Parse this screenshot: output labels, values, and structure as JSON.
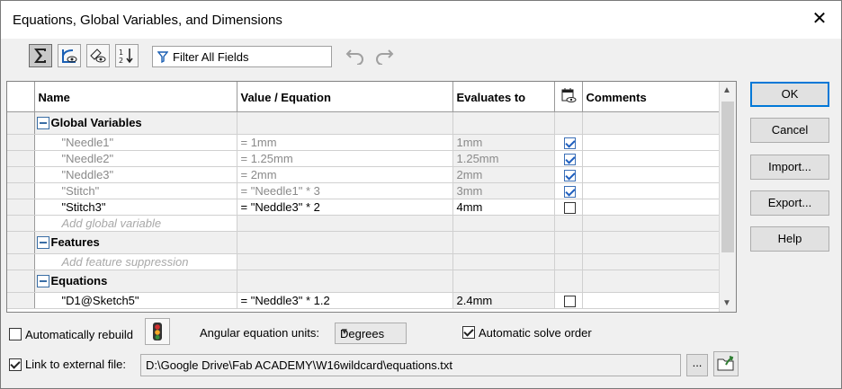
{
  "window": {
    "title": "Equations, Global Variables, and Dimensions"
  },
  "toolbar": {
    "filter_placeholder": "Filter All Fields",
    "buttons": [
      "equation-view-icon",
      "sketch-equation-view-icon",
      "dimension-view-icon",
      "ordered-view-icon"
    ]
  },
  "columns": {
    "name": "Name",
    "value": "Value / Equation",
    "evaluates": "Evaluates to",
    "comments": "Comments"
  },
  "sections": {
    "global": "Global Variables",
    "features": "Features",
    "equations": "Equations"
  },
  "global_variables": [
    {
      "name": "\"Needle1\"",
      "value": "= 1mm",
      "evaluates": "1mm",
      "checked": true,
      "dim": true
    },
    {
      "name": "\"Needle2\"",
      "value": "= 1.25mm",
      "evaluates": "1.25mm",
      "checked": true,
      "dim": true
    },
    {
      "name": "\"Neddle3\"",
      "value": "= 2mm",
      "evaluates": "2mm",
      "checked": true,
      "dim": true
    },
    {
      "name": "\"Stitch\"",
      "value": "= \"Needle1\" * 3",
      "evaluates": "3mm",
      "checked": true,
      "dim": true
    },
    {
      "name": "\"Stitch3\"",
      "value": "= \"Neddle3\" * 2",
      "evaluates": "4mm",
      "checked": false,
      "dim": false
    }
  ],
  "placeholders": {
    "add_global": "Add global variable",
    "add_feature": "Add feature suppression"
  },
  "equations": [
    {
      "name": "\"D1@Sketch5\"",
      "value": "= \"Neddle3\" * 1.2",
      "evaluates": "2.4mm",
      "checked": false
    }
  ],
  "buttons": {
    "ok": "OK",
    "cancel": "Cancel",
    "import": "Import...",
    "export": "Export...",
    "help": "Help"
  },
  "footer": {
    "auto_rebuild": "Automatically rebuild",
    "auto_rebuild_checked": false,
    "angular_units_label": "Angular equation units:",
    "angular_units_value": "Degrees",
    "auto_solve": "Automatic solve order",
    "auto_solve_checked": true,
    "link_file": "Link to external file:",
    "link_file_checked": true,
    "file_path": "D:\\Google Drive\\Fab ACADEMY\\W16wildcard\\equations.txt",
    "browse_label": "..."
  },
  "colors": {
    "accent": "#0078d7",
    "check": "#1f5fbf",
    "dim_text": "#8a8a8a"
  }
}
